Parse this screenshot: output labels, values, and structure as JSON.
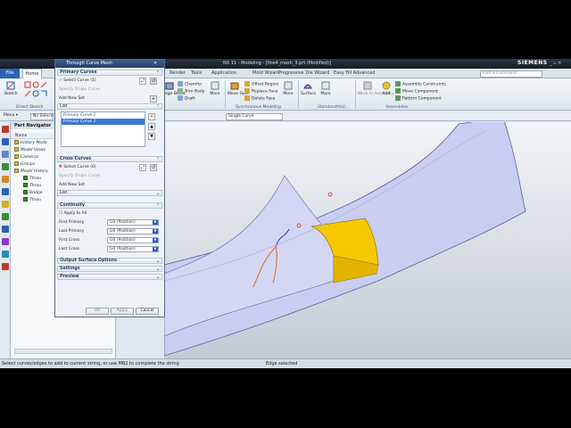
{
  "window": {
    "title": "NX 11 - Modeling - [ftre4_mesh_3.prt (Modified)]",
    "brand": "SIEMENS",
    "controls": "_ ▫ ✕"
  },
  "menu": {
    "file": "File",
    "home": "Home",
    "tabs": [
      "Render",
      "Tools",
      "Application",
      "Mold Wizard",
      "Progressive Die Wizard",
      "Easy Fill Advanced"
    ],
    "search_placeholder": "Find a Command"
  },
  "ribbon": {
    "sketch": "Sketch",
    "direct_sketch": "Direct Sketch",
    "edge_blend": "Edge Blend",
    "chamfer": "Chamfer",
    "trim_body": "Trim Body",
    "draft": "Draft",
    "more1": "More",
    "move_face": "Move Face",
    "offset_region": "Offset Region",
    "replace_face": "Replace Face",
    "delete_face": "Delete Face",
    "more2": "More",
    "surface": "Surface",
    "more3": "More",
    "work_in_assembly": "Work in Assembly",
    "add": "Add",
    "assembly_constraints": "Assembly Constraints",
    "move_component": "Move Component",
    "pattern_component": "Pattern Component",
    "groups": [
      "Direct Sketch",
      "Synchronous Modeling",
      "Standard(Vol)...",
      "Assemblies"
    ]
  },
  "selection": {
    "menu": "Menu ▾",
    "filter": "No Selecti",
    "curve_rule": "Single Curve"
  },
  "navigator": {
    "title": "Part Navigator",
    "column": "Name",
    "items": [
      "History Mode",
      "Model Views",
      "Cameras",
      "Groups",
      "Model History",
      "Throu",
      "Throu",
      "Bridge",
      "Throu"
    ]
  },
  "dialog": {
    "title": "Through Curve Mesh",
    "primary_curves": "Primary Curves",
    "select_curve_1": "Select Curve (1)",
    "specify_origin_1": "Specify Origin Curve",
    "add_new_set_1": "Add New Set",
    "list_1": "List",
    "list_items": [
      "Primary Curve 1",
      "Primary Curve 2"
    ],
    "cross_curves": "Cross Curves",
    "select_curve_0": "Select Curve (0)",
    "specify_origin_2": "Specify Origin Curve",
    "add_new_set_2": "Add New Set",
    "list_2": "List",
    "continuity": "Continuity",
    "apply_all": "Apply to All",
    "first_primary": "First Primary",
    "last_primary": "Last Primary",
    "first_cross": "First Cross",
    "last_cross": "Last Cross",
    "g0": "G0 (Position)",
    "output_surface_options": "Output Surface Options",
    "settings": "Settings",
    "preview": "Preview",
    "ok": "OK",
    "apply": "Apply",
    "cancel": "Cancel"
  },
  "status": {
    "prompt": "Select curves/edges to add to current string, or use MB2 to complete the string",
    "message": "Edge selected"
  },
  "colors": {
    "accent": "#2a62b7",
    "surface": "#c9cdf0",
    "highlight": "#f5c800"
  },
  "icons": [
    "sketch-icon",
    "edge-blend-icon",
    "surface-icon",
    "add-icon",
    "curve-icon",
    "reverse-icon"
  ]
}
